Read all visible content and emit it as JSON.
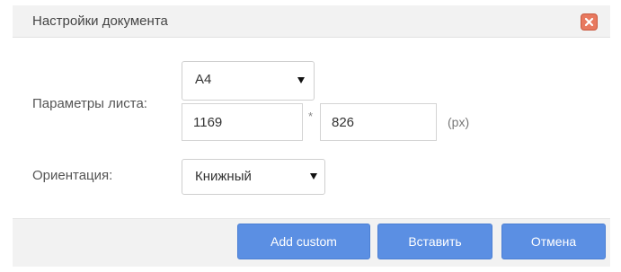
{
  "dialog": {
    "title": "Настройки документа",
    "close_icon": "close-x-icon"
  },
  "sheet": {
    "label": "Параметры листа:",
    "size_value": "A4",
    "width_value": "1169",
    "separator": "*",
    "height_value": "826",
    "unit": "(px)"
  },
  "orientation": {
    "label": "Ориентация:",
    "value": "Книжный"
  },
  "buttons": {
    "add_custom": "Add custom",
    "insert": "Вставить",
    "cancel": "Отмена"
  },
  "colors": {
    "button_bg": "#5b8fe3",
    "close_bg": "#e8795f",
    "bar_bg": "#f2f2f2"
  }
}
